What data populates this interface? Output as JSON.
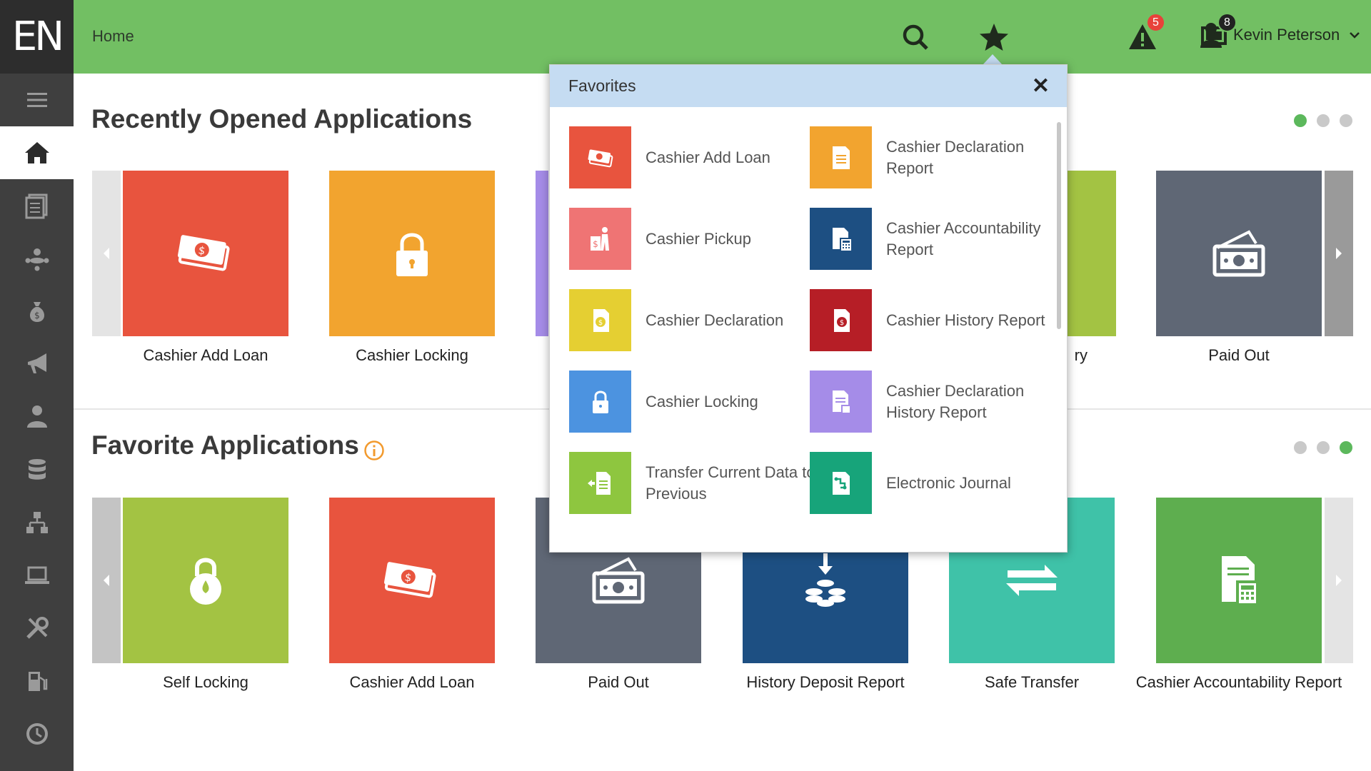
{
  "logo": "EN",
  "header": {
    "breadcrumb": "Home",
    "alerts_count": "5",
    "screens_count": "8",
    "user_name": "Kevin Peterson"
  },
  "sidebar": {
    "items": [
      {
        "icon": "menu-icon"
      },
      {
        "icon": "home-icon",
        "active": true
      },
      {
        "icon": "documents-icon"
      },
      {
        "icon": "org-chart-icon"
      },
      {
        "icon": "money-bag-icon"
      },
      {
        "icon": "megaphone-icon"
      },
      {
        "icon": "users-icon"
      },
      {
        "icon": "database-icon"
      },
      {
        "icon": "network-icon"
      },
      {
        "icon": "laptop-icon"
      },
      {
        "icon": "tools-icon"
      },
      {
        "icon": "fuel-icon"
      },
      {
        "icon": "clock-icon"
      }
    ]
  },
  "recent": {
    "title": "Recently Opened Applications",
    "tiles": [
      {
        "label": "Cashier Add Loan",
        "color": "#e8543e",
        "icon": "cash-icon"
      },
      {
        "label": "Cashier Locking",
        "color": "#f2a42f",
        "icon": "lock-icon"
      },
      {
        "label": "",
        "color": "#a58ce8",
        "icon": ""
      },
      {
        "label": "ry",
        "color": "#a3c343",
        "icon": ""
      },
      {
        "label": "Paid Out",
        "color": "#5f6775",
        "icon": "paid-out-icon"
      }
    ]
  },
  "favorites_section": {
    "title": "Favorite Applications",
    "tiles": [
      {
        "label": "Self Locking",
        "color": "#a3c343",
        "icon": "self-lock-icon"
      },
      {
        "label": "Cashier Add Loan",
        "color": "#e8543e",
        "icon": "cash-icon"
      },
      {
        "label": "Paid Out",
        "color": "#5f6775",
        "icon": "paid-out-icon"
      },
      {
        "label": "History Deposit Report",
        "color": "#1d4f82",
        "icon": "deposit-icon"
      },
      {
        "label": "Safe Transfer",
        "color": "#3fc2a8",
        "icon": "transfer-icon"
      },
      {
        "label": "Cashier Accountability Report",
        "color": "#5eae4f",
        "icon": "report-icon"
      }
    ]
  },
  "popup": {
    "title": "Favorites",
    "items": [
      {
        "label": "Cashier Add Loan",
        "color": "#e8543e",
        "icon": "cash-icon"
      },
      {
        "label": "Cashier Declaration Report",
        "color": "#f2a42f",
        "icon": "document-icon"
      },
      {
        "label": "Cashier Pickup",
        "color": "#ef7474",
        "icon": "pickup-icon"
      },
      {
        "label": "Cashier Accountability Report",
        "color": "#1d4f82",
        "icon": "calculator-report-icon"
      },
      {
        "label": "Cashier Declaration",
        "color": "#e5cf32",
        "icon": "declaration-icon"
      },
      {
        "label": "Cashier History Report",
        "color": "#b61e26",
        "icon": "history-report-icon"
      },
      {
        "label": "Cashier Locking",
        "color": "#4c93e0",
        "icon": "lock-icon"
      },
      {
        "label": "Cashier Declaration History Report",
        "color": "#a58ce8",
        "icon": "declaration-history-icon"
      },
      {
        "label": "Transfer Current Data to Previous",
        "color": "#8ec63f",
        "icon": "transfer-data-icon"
      },
      {
        "label": "Electronic Journal",
        "color": "#17a47a",
        "icon": "journal-icon"
      }
    ]
  }
}
